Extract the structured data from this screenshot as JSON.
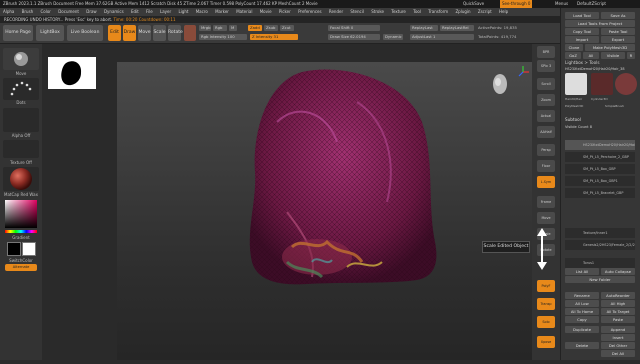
{
  "titlebar": {
    "text": "ZBrush 2023.1.1   ZBrush Document   Free Mem 37.62GB   Active Mem 1412   Scratch Disk 45   ZTime 2.067   Timer 0.598   PolyCount 17.462 KP   MeshCount 2   Movie",
    "menu_btns": [
      "QuickSave",
      "See-through 0",
      "Menus",
      "DefaultZScript"
    ]
  },
  "menubar": {
    "items": [
      "Alpha",
      "Brush",
      "Color",
      "Document",
      "Draw",
      "Dynamics",
      "Edit",
      "File",
      "Layer",
      "Light",
      "Macro",
      "Marker",
      "Material",
      "Movie",
      "Picker",
      "Preferences",
      "Render",
      "Stencil",
      "Stroke",
      "Texture",
      "Tool",
      "Transform",
      "Zplugin",
      "Zscript",
      "Help"
    ]
  },
  "notice": {
    "prefix": "RECORDING UNDO HISTORY... Press 'Esc' key to abort.",
    "time": "Time: 00:20 Countdown: 00:11"
  },
  "toolbar": {
    "home": "Home Page",
    "lightbox": "LightBox",
    "live_boolean": "Live Boolean",
    "edit": "Edit",
    "draw": "Draw",
    "move": "Move",
    "scale": "Scale",
    "rotate": "Rotate",
    "mrgb": "Mrgb",
    "rgb": "Rgb",
    "m": "M",
    "zadd": "Zadd",
    "zsub": "Zsub",
    "zcut": "Zcut",
    "rgb_intensity": "Rgb Intensity 100",
    "z_intensity": "Z Intensity 31",
    "focal_shift": "Focal Shift 0",
    "draw_size": "Draw Size 62.0194",
    "dynamic": "Dynamic",
    "replay_last": "ReplayLast",
    "replay_last_rel": "ReplayLastRel",
    "active_points": "ActivePoints: 19,835",
    "total_points": "TotalPoints: 419,774",
    "adjust_last": "AdjustLast 1"
  },
  "left": {
    "move": "Move",
    "dots": "Dots",
    "alpha_off": "Alpha Off",
    "texture_off": "Texture Off",
    "material": "MatCap Red Wax",
    "gradient": "Gradient",
    "switch_color": "SwitchColor",
    "alternate": "Alternate"
  },
  "right_strip": {
    "buttons": [
      "BPR",
      "SPix 3",
      "Scroll",
      "Zoom",
      "Actual",
      "AAHalf",
      "Persp",
      "Floor",
      "L.Sym",
      "Frame",
      "Move",
      "Scale",
      "Rotate",
      "PolyF",
      "Transp",
      "Solo",
      "Xpose"
    ]
  },
  "tooltip": {
    "text": "Scale Edited Object"
  },
  "right_panel": {
    "load_tool": "Load Tool",
    "save_as": "Save As",
    "load_tools_from_project": "Load Tools From Project",
    "copy_tool": "Copy Tool",
    "paste_tool": "Paste Tool",
    "import": "Import",
    "export": "Export",
    "clone": "Clone",
    "make_polymesh3d": "Make PolyMesh3D",
    "goz": "GoZ",
    "all": "All",
    "visible": "Visible",
    "r": "R",
    "lightbox_tools": "Lightbox > Tools",
    "current_tool": "HS23XtxtDemoH20/Hair20/Hair_38",
    "tool_names": [
      "Hair20/Hair",
      "Cylinder3D",
      "PolyMesh3D",
      "SimpleBrush"
    ],
    "subtool": "Subtool",
    "visible_count": "Visible Count 8",
    "subtools": [
      "HS23XtxtDemoH20/Hair20/Hair08P7",
      "SM_Pt_L5_Perchoire_2_GBP",
      "SM_Pt_L5_Box_GBP",
      "SM_Pt_L5_Box_GBP1",
      "SM_Pt_L5_Bracelet_GBP",
      "Texture/Inner1",
      "Genesis2/2HS23/Female_2/2/2",
      "Torus1"
    ],
    "list_all": "List All",
    "auto_collapse": "Auto Collapse",
    "new_folder": "New Folder",
    "rename": "Rename",
    "auto_reorder": "AutoReorder",
    "all_low": "All Low",
    "all_high": "All High",
    "all_to_home": "All To Home",
    "all_to_target": "All To Target",
    "copy": "Copy",
    "paste": "Paste",
    "duplicate": "Duplicate",
    "append": "Append",
    "insert": "Insert",
    "delete": "Delete",
    "del_other": "Del Other",
    "del_all": "Del All"
  },
  "colors": {
    "accent": "#e8891a",
    "hair": "#7a1f4f"
  }
}
